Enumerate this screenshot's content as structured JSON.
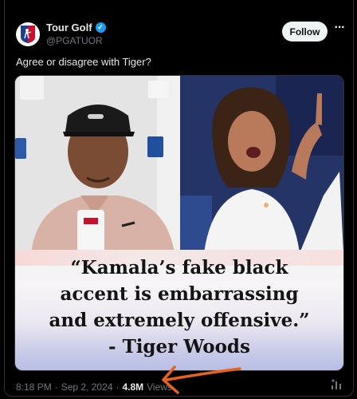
{
  "post": {
    "author_name": "Tour Golf",
    "author_handle": "@PGATUOR",
    "follow_label": "Follow",
    "more_label": "···",
    "text": "Agree or disagree with Tiger?",
    "image_quote": {
      "line1": "“Kamala’s fake black",
      "line2": "accent is embarrassing",
      "line3": "and extremely offensive.”",
      "line4": "- Tiger Woods"
    },
    "time": "8:18 PM",
    "separator": "·",
    "date": "Sep 2, 2024",
    "views_count": "4.8M",
    "views_label": "Views"
  },
  "colors": {
    "background": "#000000",
    "accent_verified": "#1d9bf0",
    "annotation_arrow": "#e8621e"
  },
  "icons": {
    "verified": "verified-badge-icon",
    "more": "more-icon",
    "stats": "bar-chart-icon",
    "avatar": "pga-tour-logo-icon"
  }
}
